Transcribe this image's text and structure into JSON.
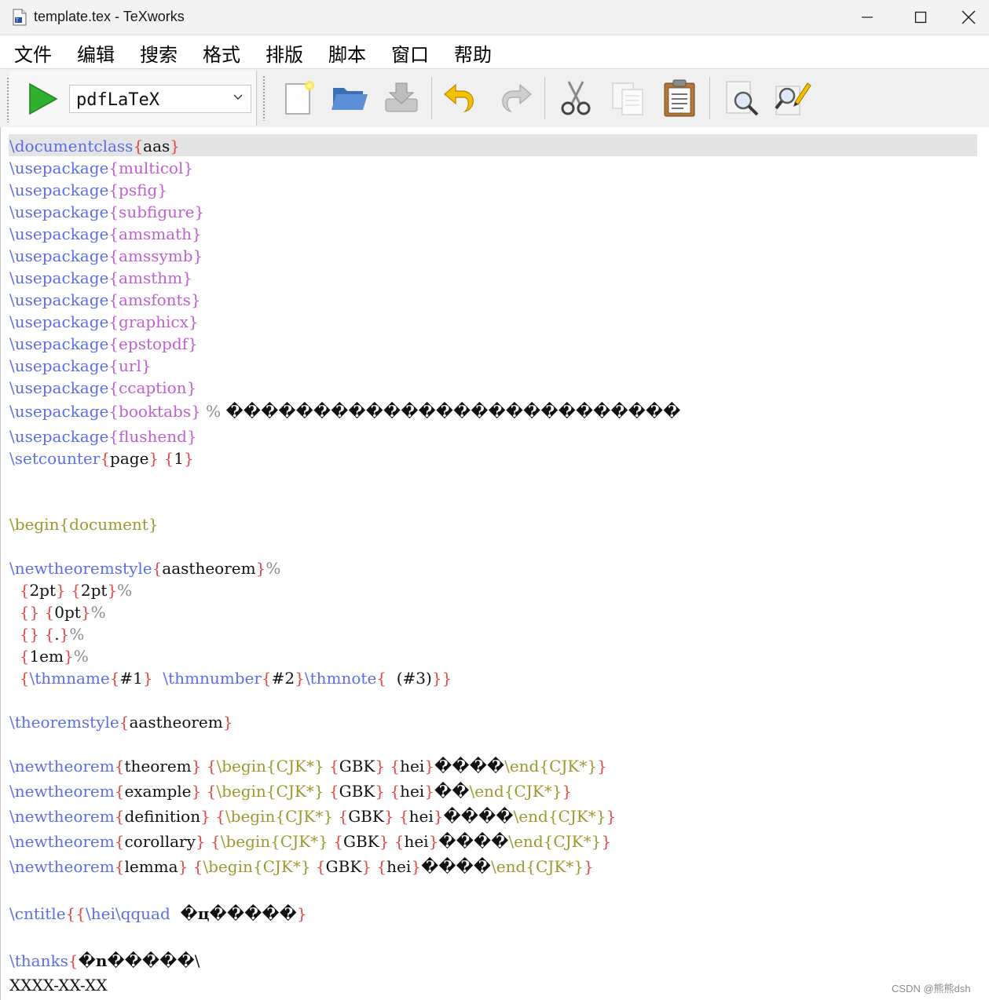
{
  "window": {
    "title": "template.tex - TeXworks",
    "controls": [
      "minimize",
      "maximize",
      "close"
    ]
  },
  "menubar": [
    "文件",
    "编辑",
    "搜索",
    "格式",
    "排版",
    "脚本",
    "窗口",
    "帮助"
  ],
  "toolbar": {
    "typeset_engine": "pdfLaTeX",
    "buttons": [
      "typeset",
      "new-document",
      "open",
      "save",
      "undo",
      "redo",
      "cut",
      "copy",
      "paste",
      "find",
      "replace"
    ]
  },
  "colors": {
    "command": "#5a6ee8",
    "package": "#c05fd2",
    "brace": "#e04848",
    "environment": "#9a9a2c",
    "comment": "#8a8a8a",
    "current_line": "#e4e4e4",
    "typeset_green": "#2fb12f"
  },
  "editor": {
    "lines": [
      [
        [
          "cmd",
          "\\documentclass"
        ],
        [
          "brace",
          "{"
        ],
        [
          "text",
          "aas"
        ],
        [
          "brace",
          "}"
        ]
      ],
      [
        [
          "cmd",
          "\\usepackage"
        ],
        [
          "pkg",
          "{multicol}"
        ]
      ],
      [
        [
          "cmd",
          "\\usepackage"
        ],
        [
          "pkg",
          "{psfig}"
        ]
      ],
      [
        [
          "cmd",
          "\\usepackage"
        ],
        [
          "pkg",
          "{subfigure}"
        ]
      ],
      [
        [
          "cmd",
          "\\usepackage"
        ],
        [
          "pkg",
          "{amsmath}"
        ]
      ],
      [
        [
          "cmd",
          "\\usepackage"
        ],
        [
          "pkg",
          "{amssymb}"
        ]
      ],
      [
        [
          "cmd",
          "\\usepackage"
        ],
        [
          "pkg",
          "{amsthm}"
        ]
      ],
      [
        [
          "cmd",
          "\\usepackage"
        ],
        [
          "pkg",
          "{amsfonts}"
        ]
      ],
      [
        [
          "cmd",
          "\\usepackage"
        ],
        [
          "pkg",
          "{graphicx}"
        ]
      ],
      [
        [
          "cmd",
          "\\usepackage"
        ],
        [
          "pkg",
          "{epstopdf}"
        ]
      ],
      [
        [
          "cmd",
          "\\usepackage"
        ],
        [
          "pkg",
          "{url}"
        ]
      ],
      [
        [
          "cmd",
          "\\usepackage"
        ],
        [
          "pkg",
          "{ccaption}"
        ]
      ],
      [
        [
          "cmd",
          "\\usepackage"
        ],
        [
          "pkg",
          "{booktabs}"
        ],
        [
          "comment",
          " % "
        ],
        [
          "garbled",
          "��������������������������"
        ]
      ],
      [
        [
          "cmd",
          "\\usepackage"
        ],
        [
          "pkg",
          "{flushend}"
        ]
      ],
      [
        [
          "cmd",
          "\\setcounter"
        ],
        [
          "brace",
          "{"
        ],
        [
          "text",
          "page"
        ],
        [
          "brace",
          "}"
        ],
        [
          "brace",
          " {"
        ],
        [
          "text",
          "1"
        ],
        [
          "brace",
          "}"
        ]
      ],
      [
        [
          "env",
          "\\begin{document}"
        ]
      ],
      [
        [
          "cmd",
          "\\newtheoremstyle"
        ],
        [
          "brace",
          "{"
        ],
        [
          "text",
          "aastheorem"
        ],
        [
          "brace",
          "}"
        ],
        [
          "comment",
          "%"
        ]
      ],
      [
        [
          "text",
          "  "
        ],
        [
          "brace",
          "{"
        ],
        [
          "text",
          "2pt"
        ],
        [
          "brace",
          "}"
        ],
        [
          "brace",
          " {"
        ],
        [
          "text",
          "2pt"
        ],
        [
          "brace",
          "}"
        ],
        [
          "comment",
          "%"
        ]
      ],
      [
        [
          "text",
          "  "
        ],
        [
          "brace",
          "{}"
        ],
        [
          "brace",
          " {"
        ],
        [
          "text",
          "0pt"
        ],
        [
          "brace",
          "}"
        ],
        [
          "comment",
          "%"
        ]
      ],
      [
        [
          "text",
          "  "
        ],
        [
          "brace",
          "{}"
        ],
        [
          "brace",
          " {"
        ],
        [
          "text",
          "."
        ],
        [
          "brace",
          "}"
        ],
        [
          "comment",
          "%"
        ]
      ],
      [
        [
          "text",
          "  "
        ],
        [
          "brace",
          "{"
        ],
        [
          "text",
          "1em"
        ],
        [
          "brace",
          "}"
        ],
        [
          "comment",
          "%"
        ]
      ],
      [
        [
          "text",
          "  "
        ],
        [
          "brace",
          "{"
        ],
        [
          "cmd",
          "\\thmname"
        ],
        [
          "brace",
          "{"
        ],
        [
          "text",
          "#1"
        ],
        [
          "brace",
          "}"
        ],
        [
          "text",
          "  "
        ],
        [
          "cmd",
          "\\thmnumber"
        ],
        [
          "brace",
          "{"
        ],
        [
          "text",
          "#2"
        ],
        [
          "brace",
          "}"
        ],
        [
          "cmd",
          "\\thmnote"
        ],
        [
          "brace",
          "{"
        ],
        [
          "text",
          "  (#3)"
        ],
        [
          "brace",
          "}}"
        ]
      ],
      [
        [
          "cmd",
          "\\theoremstyle"
        ],
        [
          "brace",
          "{"
        ],
        [
          "text",
          "aastheorem"
        ],
        [
          "brace",
          "}"
        ]
      ],
      [
        [
          "cmd",
          "\\newtheorem"
        ],
        [
          "brace",
          "{"
        ],
        [
          "text",
          "theorem"
        ],
        [
          "brace",
          "}"
        ],
        [
          "brace",
          " {"
        ],
        [
          "env",
          "\\begin{CJK*}"
        ],
        [
          "brace",
          " {"
        ],
        [
          "text",
          "GBK"
        ],
        [
          "brace",
          "}"
        ],
        [
          "brace",
          " {"
        ],
        [
          "text",
          "hei"
        ],
        [
          "brace",
          "}"
        ],
        [
          "garbled",
          "����"
        ],
        [
          "env",
          "\\end{CJK*}"
        ],
        [
          "brace",
          "}"
        ]
      ],
      [
        [
          "cmd",
          "\\newtheorem"
        ],
        [
          "brace",
          "{"
        ],
        [
          "text",
          "example"
        ],
        [
          "brace",
          "}"
        ],
        [
          "brace",
          " {"
        ],
        [
          "env",
          "\\begin{CJK*}"
        ],
        [
          "brace",
          " {"
        ],
        [
          "text",
          "GBK"
        ],
        [
          "brace",
          "}"
        ],
        [
          "brace",
          " {"
        ],
        [
          "text",
          "hei"
        ],
        [
          "brace",
          "}"
        ],
        [
          "garbled",
          "��"
        ],
        [
          "env",
          "\\end{CJK*}"
        ],
        [
          "brace",
          "}"
        ]
      ],
      [
        [
          "cmd",
          "\\newtheorem"
        ],
        [
          "brace",
          "{"
        ],
        [
          "text",
          "definition"
        ],
        [
          "brace",
          "}"
        ],
        [
          "brace",
          " {"
        ],
        [
          "env",
          "\\begin{CJK*}"
        ],
        [
          "brace",
          " {"
        ],
        [
          "text",
          "GBK"
        ],
        [
          "brace",
          "}"
        ],
        [
          "brace",
          " {"
        ],
        [
          "text",
          "hei"
        ],
        [
          "brace",
          "}"
        ],
        [
          "garbled",
          "����"
        ],
        [
          "env",
          "\\end{CJK*}"
        ],
        [
          "brace",
          "}"
        ]
      ],
      [
        [
          "cmd",
          "\\newtheorem"
        ],
        [
          "brace",
          "{"
        ],
        [
          "text",
          "corollary"
        ],
        [
          "brace",
          "}"
        ],
        [
          "brace",
          " {"
        ],
        [
          "env",
          "\\begin{CJK*}"
        ],
        [
          "brace",
          " {"
        ],
        [
          "text",
          "GBK"
        ],
        [
          "brace",
          "}"
        ],
        [
          "brace",
          " {"
        ],
        [
          "text",
          "hei"
        ],
        [
          "brace",
          "}"
        ],
        [
          "garbled",
          "����"
        ],
        [
          "env",
          "\\end{CJK*}"
        ],
        [
          "brace",
          "}"
        ]
      ],
      [
        [
          "cmd",
          "\\newtheorem"
        ],
        [
          "brace",
          "{"
        ],
        [
          "text",
          "lemma"
        ],
        [
          "brace",
          "}"
        ],
        [
          "brace",
          " {"
        ],
        [
          "env",
          "\\begin{CJK*}"
        ],
        [
          "brace",
          " {"
        ],
        [
          "text",
          "GBK"
        ],
        [
          "brace",
          "}"
        ],
        [
          "brace",
          " {"
        ],
        [
          "text",
          "hei"
        ],
        [
          "brace",
          "}"
        ],
        [
          "garbled",
          "����"
        ],
        [
          "env",
          "\\end{CJK*}"
        ],
        [
          "brace",
          "}"
        ]
      ],
      [
        [
          "cmd",
          "\\cntitle"
        ],
        [
          "brace",
          "{{"
        ],
        [
          "cmd",
          "\\hei\\qquad"
        ],
        [
          "text",
          "  "
        ],
        [
          "garbled",
          "�ц�����"
        ],
        [
          "brace",
          "}"
        ]
      ],
      [
        [
          "cmd",
          "\\thanks"
        ],
        [
          "brace",
          "{"
        ],
        [
          "garbled",
          "�n�����"
        ],
        [
          "text",
          "\\"
        ]
      ],
      [
        [
          "text",
          "XXXX-XX-XX"
        ]
      ]
    ]
  },
  "watermark": "CSDN @熊熊dsh"
}
